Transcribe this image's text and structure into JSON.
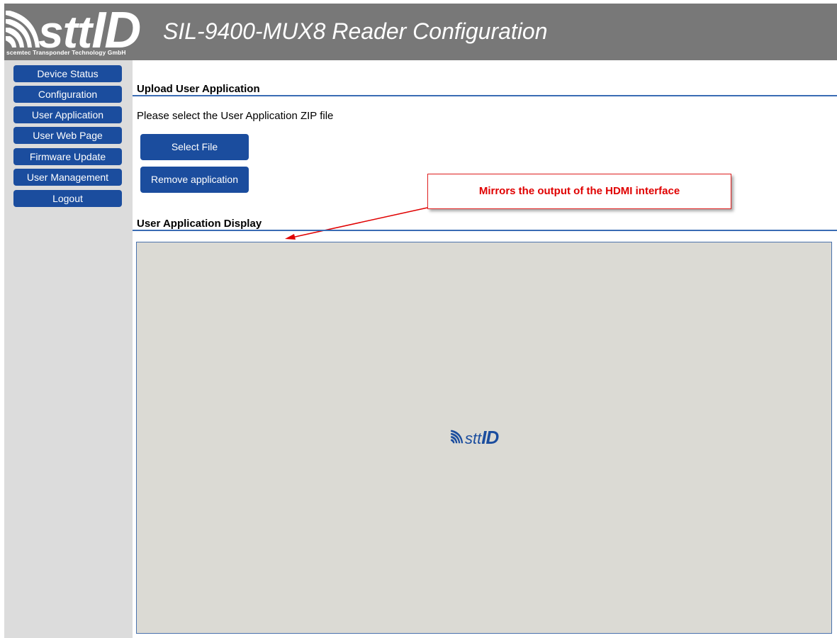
{
  "header": {
    "logo_word": "stt",
    "logo_word_id": "ID",
    "logo_subtitle": "scemtec Transponder Technology GmbH",
    "title": "SIL-9400-MUX8 Reader Configuration"
  },
  "sidebar": {
    "items": [
      {
        "label": "Device Status"
      },
      {
        "label": "Configuration"
      },
      {
        "label": "User Application"
      },
      {
        "label": "User Web Page"
      },
      {
        "label": "Firmware Update"
      },
      {
        "label": "User Management"
      },
      {
        "label": "Logout"
      }
    ]
  },
  "main": {
    "upload_title": "Upload User Application",
    "instruction": "Please select the User Application ZIP file",
    "select_file_label": "Select File",
    "remove_label": "Remove application",
    "display_title": "User Application Display",
    "display_logo_word": "stt",
    "display_logo_word_id": "ID"
  },
  "annotation": {
    "callout_text": "Mirrors the output of the HDMI interface"
  },
  "colors": {
    "header_bg": "#787878",
    "sidebar_bg": "#dcdcdc",
    "button_blue": "#1b4d9e",
    "rule_blue": "#3a6cb4",
    "display_bg": "#dbdad4",
    "callout_red": "#e00000"
  },
  "icons": {
    "logo_mark": "rfid-waves-icon",
    "callout_arrow": "arrow-icon"
  }
}
